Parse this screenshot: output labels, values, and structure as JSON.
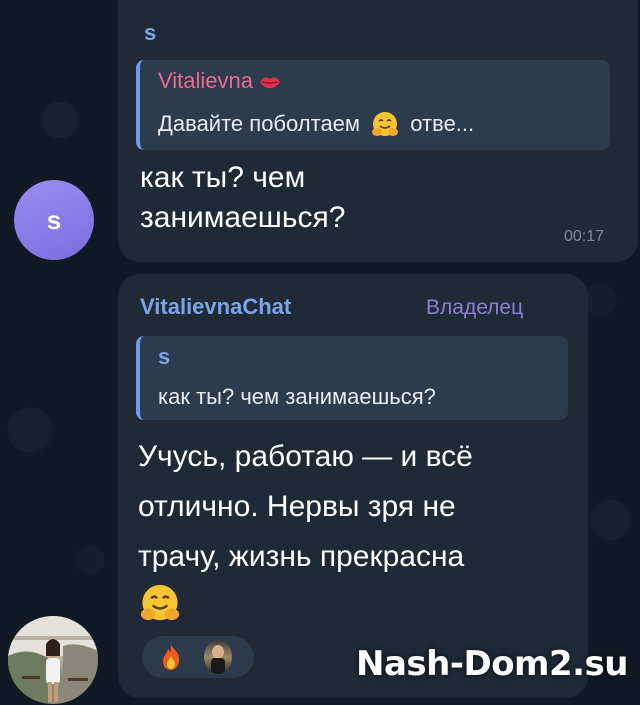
{
  "messages": [
    {
      "sender": "s",
      "reply": {
        "name": "Vitalievna",
        "text": "Давайте поболтаем",
        "suffix": "отве..."
      },
      "text_lines": [
        "как ты? чем",
        "занимаешься?"
      ],
      "time": "00:17",
      "avatar_letter": "s"
    },
    {
      "sender": "VitalievnaChat",
      "badge": "Владелец",
      "reply": {
        "name": "s",
        "text": "как ты? чем занимаешься?"
      },
      "text_lines": [
        "Учусь, работаю — и всё",
        "отлично. Нервы зря не",
        "трачу, жизнь прекрасна"
      ],
      "reactions": [
        "fire",
        "photo-avatar"
      ]
    }
  ],
  "watermark": "Nash-Dom2.su",
  "colors": {
    "background": "#0e1621",
    "bubble": "#1f2a36",
    "sender_name": "#7aa5e8",
    "reply_pink": "#ec6a8b",
    "badge": "#8d7fd6"
  }
}
